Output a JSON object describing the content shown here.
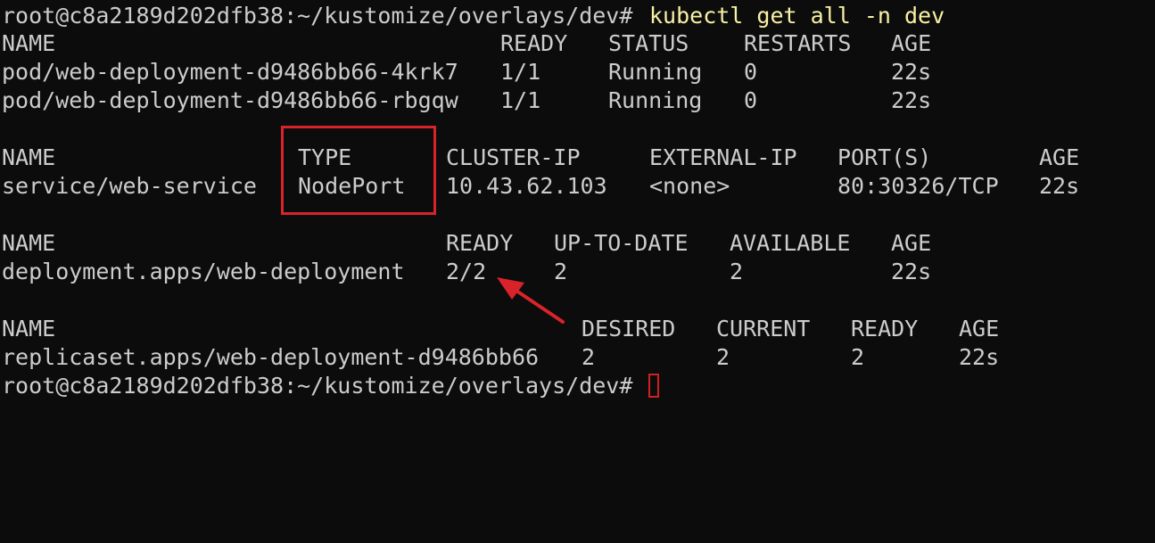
{
  "prompt": {
    "text": "root@c8a2189d202dfb38:~/kustomize/overlays/dev#",
    "command": "kubectl get all -n dev"
  },
  "pods": {
    "headers": [
      "NAME",
      "READY",
      "STATUS",
      "RESTARTS",
      "AGE"
    ],
    "rows": [
      [
        "pod/web-deployment-d9486bb66-4krk7",
        "1/1",
        "Running",
        "0",
        "22s"
      ],
      [
        "pod/web-deployment-d9486bb66-rbgqw",
        "1/1",
        "Running",
        "0",
        "22s"
      ]
    ]
  },
  "services": {
    "headers": [
      "NAME",
      "TYPE",
      "CLUSTER-IP",
      "EXTERNAL-IP",
      "PORT(S)",
      "AGE"
    ],
    "rows": [
      [
        "service/web-service",
        "NodePort",
        "10.43.62.103",
        "<none>",
        "80:30326/TCP",
        "22s"
      ]
    ]
  },
  "deployments": {
    "headers": [
      "NAME",
      "READY",
      "UP-TO-DATE",
      "AVAILABLE",
      "AGE"
    ],
    "rows": [
      [
        "deployment.apps/web-deployment",
        "2/2",
        "2",
        "2",
        "22s"
      ]
    ]
  },
  "replicasets": {
    "headers": [
      "NAME",
      "DESIRED",
      "CURRENT",
      "READY",
      "AGE"
    ],
    "rows": [
      [
        "replicaset.apps/web-deployment-d9486bb66",
        "2",
        "2",
        "2",
        "22s"
      ]
    ]
  },
  "annotations": {
    "box_color": "#d9232a",
    "arrow_color": "#d9232a"
  },
  "colors": {
    "background": "#0c0c0c",
    "text": "#cccccc",
    "command": "#f9f1a5",
    "cursor": "#d02020"
  }
}
